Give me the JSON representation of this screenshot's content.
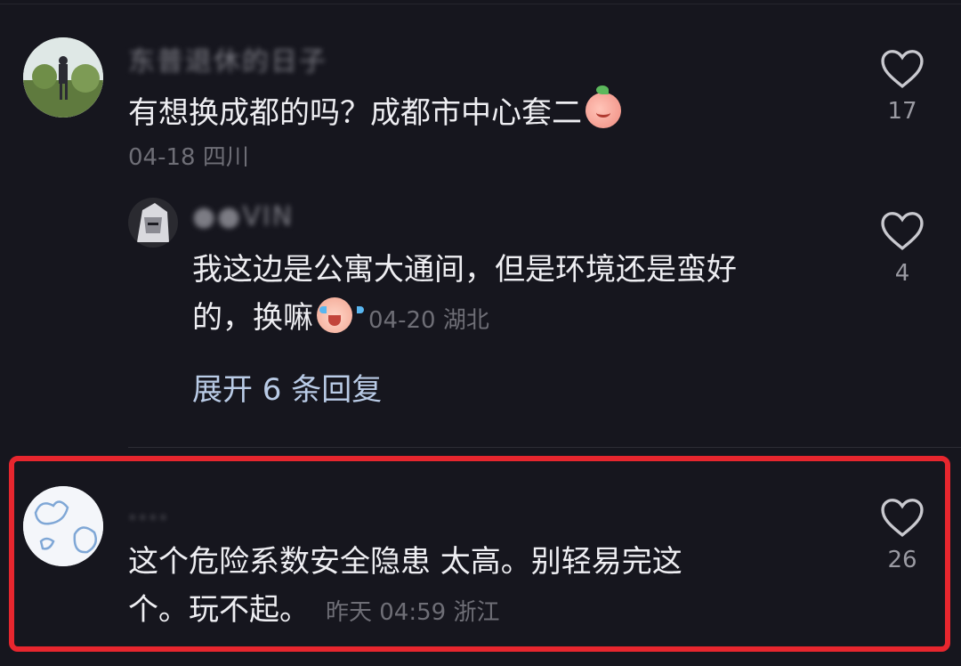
{
  "comments": [
    {
      "username": "东普退休的日子",
      "text": "有想换成都的吗？成都市中心套二",
      "emoji": "peach-emoji",
      "meta": "04-18 四川",
      "likes": "17"
    },
    {
      "username": "●●VIN",
      "text_line1": "我这边是公寓大通间，但是环境还是蛮好",
      "text_line2": "的，换嘛",
      "emoji": "laugh-cry-emoji",
      "meta": "04-20 湖北",
      "likes": "4",
      "expand_label": "展开 6 条回复"
    },
    {
      "username": "....",
      "text_line1": "这个危险系数安全隐患 太高。别轻易完这",
      "text_line2": "个。玩不起。",
      "meta": "昨天 04:59 浙江",
      "likes": "26"
    }
  ],
  "colors": {
    "background": "#16161e",
    "highlight_border": "#e7262e",
    "expand_link": "#b9cbe6"
  },
  "icons": [
    "heart-outline-icon"
  ]
}
